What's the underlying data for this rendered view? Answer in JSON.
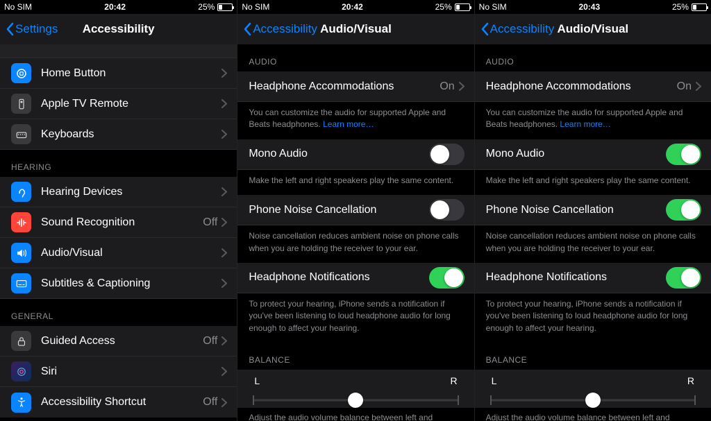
{
  "panes": [
    {
      "status": {
        "left": "No SIM",
        "time": "20:42",
        "pct": "25%",
        "battery_fill": 25
      },
      "nav": {
        "back": "Settings",
        "title": "Accessibility"
      },
      "groups": [
        {
          "header": null,
          "rows": [
            {
              "icon": "home",
              "iconBg": "#0a84ff",
              "label": "Home Button",
              "value": null
            },
            {
              "icon": "remote",
              "iconBg": "#3a3a3c",
              "label": "Apple TV Remote",
              "value": null
            },
            {
              "icon": "keyboard",
              "iconBg": "#3a3a3c",
              "label": "Keyboards",
              "value": null
            }
          ]
        },
        {
          "header": "HEARING",
          "rows": [
            {
              "icon": "ear",
              "iconBg": "#0a84ff",
              "label": "Hearing Devices",
              "value": null
            },
            {
              "icon": "sound",
              "iconBg": "#ff453a",
              "label": "Sound Recognition",
              "value": "Off"
            },
            {
              "icon": "audio",
              "iconBg": "#0a84ff",
              "label": "Audio/Visual",
              "value": null
            },
            {
              "icon": "cc",
              "iconBg": "#0a84ff",
              "label": "Subtitles & Captioning",
              "value": null
            }
          ]
        },
        {
          "header": "GENERAL",
          "rows": [
            {
              "icon": "lock",
              "iconBg": "#3a3a3c",
              "label": "Guided Access",
              "value": "Off"
            },
            {
              "icon": "siri",
              "iconBg": "#111",
              "label": "Siri",
              "value": null
            },
            {
              "icon": "shortcut",
              "iconBg": "#0a84ff",
              "label": "Accessibility Shortcut",
              "value": "Off"
            }
          ]
        }
      ]
    },
    {
      "status": {
        "left": "No SIM",
        "time": "20:42",
        "pct": "25%",
        "battery_fill": 25
      },
      "nav": {
        "back": "Accessibility",
        "title": "Audio/Visual"
      },
      "audio_header": "AUDIO",
      "headphone_accom": {
        "label": "Headphone Accommodations",
        "value": "On"
      },
      "headphone_accom_footer": "You can customize the audio for supported Apple and Beats headphones. ",
      "learn_more": "Learn more…",
      "mono": {
        "label": "Mono Audio",
        "on": false
      },
      "mono_footer": "Make the left and right speakers play the same content.",
      "pnc": {
        "label": "Phone Noise Cancellation",
        "on": false
      },
      "pnc_footer": "Noise cancellation reduces ambient noise on phone calls when you are holding the receiver to your ear.",
      "hn": {
        "label": "Headphone Notifications",
        "on": true
      },
      "hn_footer": "To protect your hearing, iPhone sends a notification if you've been listening to loud headphone audio for long enough to affect your hearing.",
      "balance_header": "BALANCE",
      "balance": {
        "l": "L",
        "r": "R",
        "pos": 50
      },
      "balance_footer_truncated": "Adjust the audio volume balance between left and"
    },
    {
      "status": {
        "left": "No SIM",
        "time": "20:43",
        "pct": "25%",
        "battery_fill": 25
      },
      "nav": {
        "back": "Accessibility",
        "title": "Audio/Visual"
      },
      "audio_header": "AUDIO",
      "headphone_accom": {
        "label": "Headphone Accommodations",
        "value": "On"
      },
      "headphone_accom_footer": "You can customize the audio for supported Apple and Beats headphones. ",
      "learn_more": "Learn more…",
      "mono": {
        "label": "Mono Audio",
        "on": true
      },
      "mono_footer": "Make the left and right speakers play the same content.",
      "pnc": {
        "label": "Phone Noise Cancellation",
        "on": true
      },
      "pnc_footer": "Noise cancellation reduces ambient noise on phone calls when you are holding the receiver to your ear.",
      "hn": {
        "label": "Headphone Notifications",
        "on": true
      },
      "hn_footer": "To protect your hearing, iPhone sends a notification if you've been listening to loud headphone audio for long enough to affect your hearing.",
      "balance_header": "BALANCE",
      "balance": {
        "l": "L",
        "r": "R",
        "pos": 50
      },
      "balance_footer_truncated": "Adjust the audio volume balance between left and"
    }
  ]
}
